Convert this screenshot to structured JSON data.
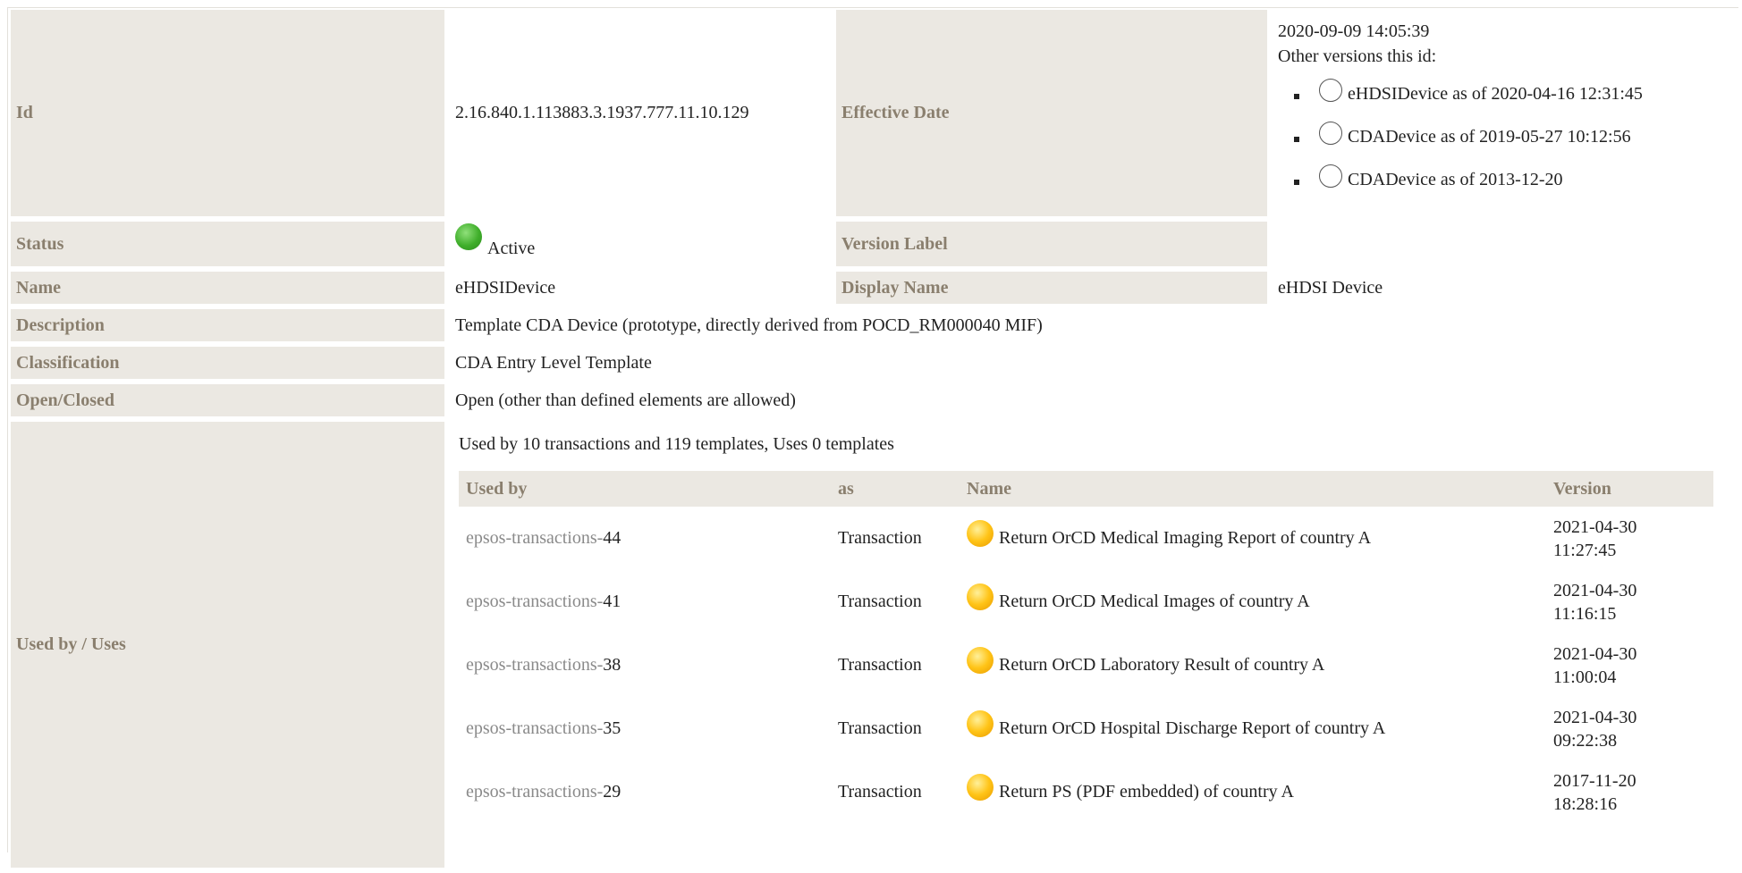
{
  "fields": {
    "id": {
      "label": "Id",
      "value": "2.16.840.1.113883.3.1937.777.11.10.129"
    },
    "effective_date": {
      "label": "Effective Date",
      "value": "2020-09-09 14:05:39",
      "other_versions_title": "Other versions this id:",
      "other_versions": [
        "eHDSIDevice as of 2020-04-16 12:31:45",
        "CDADevice as of 2019-05-27 10:12:56",
        "CDADevice as of 2013-12-20"
      ]
    },
    "status": {
      "label": "Status",
      "value": "Active",
      "icon": "green-status-dot-icon"
    },
    "version_label": {
      "label": "Version Label",
      "value": ""
    },
    "name": {
      "label": "Name",
      "value": "eHDSIDevice"
    },
    "display_name": {
      "label": "Display Name",
      "value": "eHDSI Device"
    },
    "description": {
      "label": "Description",
      "value": "Template CDA Device (prototype, directly derived from POCD_RM000040 MIF)"
    },
    "classification": {
      "label": "Classification",
      "value": "CDA Entry Level Template"
    },
    "open_closed": {
      "label": "Open/Closed",
      "value": "Open (other than defined elements are allowed)"
    },
    "used_by": {
      "label": "Used by / Uses"
    }
  },
  "usage": {
    "summary": "Used by 10 transactions and 119 templates, Uses 0 templates",
    "headers": {
      "used_by": "Used by",
      "as": "as",
      "name": "Name",
      "version": "Version"
    },
    "rows": [
      {
        "prefix": "epsos-transactions-",
        "num": "44",
        "as": "Transaction",
        "name": "Return OrCD Medical Imaging Report of country A",
        "date": "2021-04-30",
        "time": "11:27:45"
      },
      {
        "prefix": "epsos-transactions-",
        "num": "41",
        "as": "Transaction",
        "name": "Return OrCD Medical Images of country A",
        "date": "2021-04-30",
        "time": "11:16:15"
      },
      {
        "prefix": "epsos-transactions-",
        "num": "38",
        "as": "Transaction",
        "name": "Return OrCD Laboratory Result of country A",
        "date": "2021-04-30",
        "time": "11:00:04"
      },
      {
        "prefix": "epsos-transactions-",
        "num": "35",
        "as": "Transaction",
        "name": "Return OrCD Hospital Discharge Report of country A",
        "date": "2021-04-30",
        "time": "09:22:38"
      },
      {
        "prefix": "epsos-transactions-",
        "num": "29",
        "as": "Transaction",
        "name": "Return PS (PDF embedded) of country A",
        "date": "2017-11-20",
        "time": "18:28:16"
      }
    ]
  },
  "colors": {
    "label_bg": "#ebe8e2",
    "label_text": "#8a7f6e",
    "active": "#3fae2a",
    "draft": "#ffc417"
  }
}
